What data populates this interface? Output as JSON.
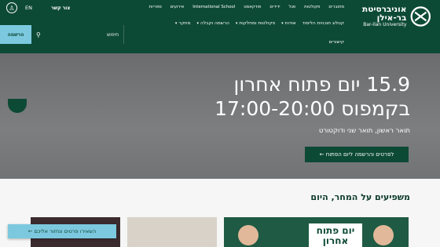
{
  "header": {
    "logo_he": "אוניברסיטת בר-אילן",
    "logo_en": "Bar-Ilan University",
    "top_links": [
      "מחוברים",
      "פקולטות",
      "פגל",
      "ידידים",
      "פודקאסט",
      "International School",
      "אירועים",
      "ספריות"
    ],
    "lang": "EN",
    "contact": "צור קשר",
    "main_nav": [
      "קטלוג תוכניות הלימוד",
      "אודות",
      "פקולטות ומחלקות",
      "הרשמה וקבלה",
      "מחקר"
    ],
    "links_row": "קישורים",
    "search_label": "חיפוש",
    "register": "הרשמה"
  },
  "hero": {
    "title": "15.9 יום פתוח אחרון בקמפוס 17:00-20:00",
    "subtitle": "תואר ראשון, תואר שני ודוקטורט",
    "cta": "לפרטים והרשמה ליום הפתוח ←"
  },
  "section": {
    "title": "משפיעים על המחר, היום",
    "open_badge": "יום פתוח אחרון",
    "stay_tuned": "השאירו פרטים ונחזור אליכם ←"
  },
  "colors": {
    "brand": "#0d4a35",
    "accent": "#7cc9df",
    "dot_active": "#b7d27b"
  },
  "icons": [
    "logo-icon",
    "accessibility-icon",
    "search-icon",
    "pause-icon",
    "chevron-down-icon"
  ]
}
